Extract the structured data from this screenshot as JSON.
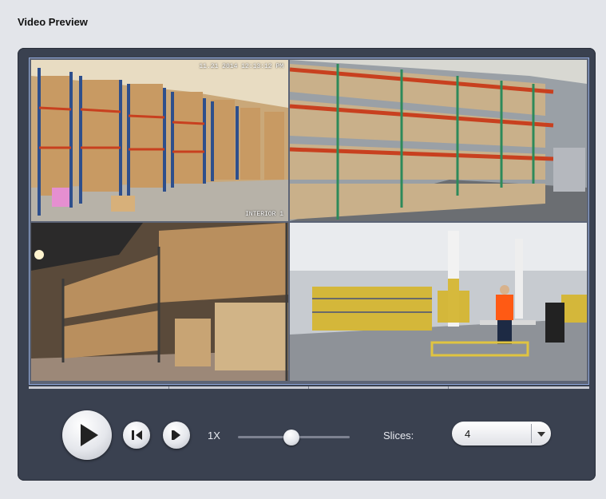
{
  "page": {
    "title": "Video Preview"
  },
  "cameras": [
    {
      "id": "cam-1",
      "osd_time": "11.21 2014 12:13:12 PM",
      "osd_label": "INTERIOR 1"
    },
    {
      "id": "cam-2"
    },
    {
      "id": "cam-3"
    },
    {
      "id": "cam-4"
    }
  ],
  "controls": {
    "speed_label": "1X",
    "speed_level_fraction": 0.48,
    "slices_label": "Slices:",
    "slices_value": "4"
  },
  "icons": {
    "play": "play-icon",
    "step_back": "step-back-icon",
    "step_forward": "step-forward-icon",
    "dropdown": "chevron-down-icon"
  },
  "colors": {
    "panel": "#3a4150",
    "frame_border": "#8ea6d8",
    "shelf_red": "#c8401f",
    "shelf_blue": "#2e4f8c",
    "vest_orange": "#ff5a14"
  }
}
